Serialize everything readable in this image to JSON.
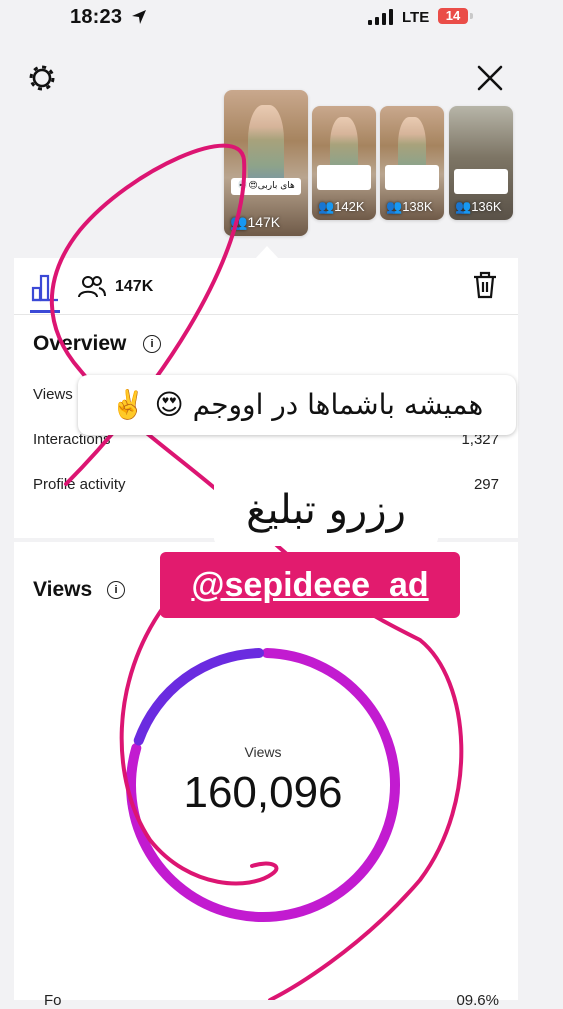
{
  "status_bar": {
    "time": "18:23",
    "network": "LTE",
    "battery": "14"
  },
  "thumbnails": [
    {
      "count": "147K",
      "caption": "های باربی😍💀"
    },
    {
      "count": "142K"
    },
    {
      "count": "138K"
    },
    {
      "count": "136K"
    }
  ],
  "tabs": {
    "followers_count": "147K"
  },
  "overview": {
    "title": "Overview",
    "rows": [
      {
        "label": "Views",
        "value": ""
      },
      {
        "label": "Interactions",
        "value": "1,327"
      },
      {
        "label": "Profile activity",
        "value": "297"
      }
    ]
  },
  "views_section": {
    "title": "Views",
    "center_label": "Views",
    "total": "160,096",
    "footer_label": "Fo",
    "footer_value": "09.6%"
  },
  "chart_data": {
    "type": "donut",
    "center_label": "Views",
    "total": "160,096",
    "segments": [
      {
        "name": "",
        "value": 0.8,
        "color": "#c21bd0"
      },
      {
        "name": "",
        "value": 0.2,
        "color": "#6a2be0"
      }
    ]
  },
  "stickers": {
    "caption": "همیشه باشماها در اووجم 😍 ✌️",
    "ad_text": "رزرو تبلیغ",
    "handle": "@sepideee_ad"
  },
  "colors": {
    "accent": "#e21b6e",
    "donut_primary": "#c21bd0",
    "donut_secondary": "#6a2be0",
    "tab_active": "#3b49d6"
  }
}
